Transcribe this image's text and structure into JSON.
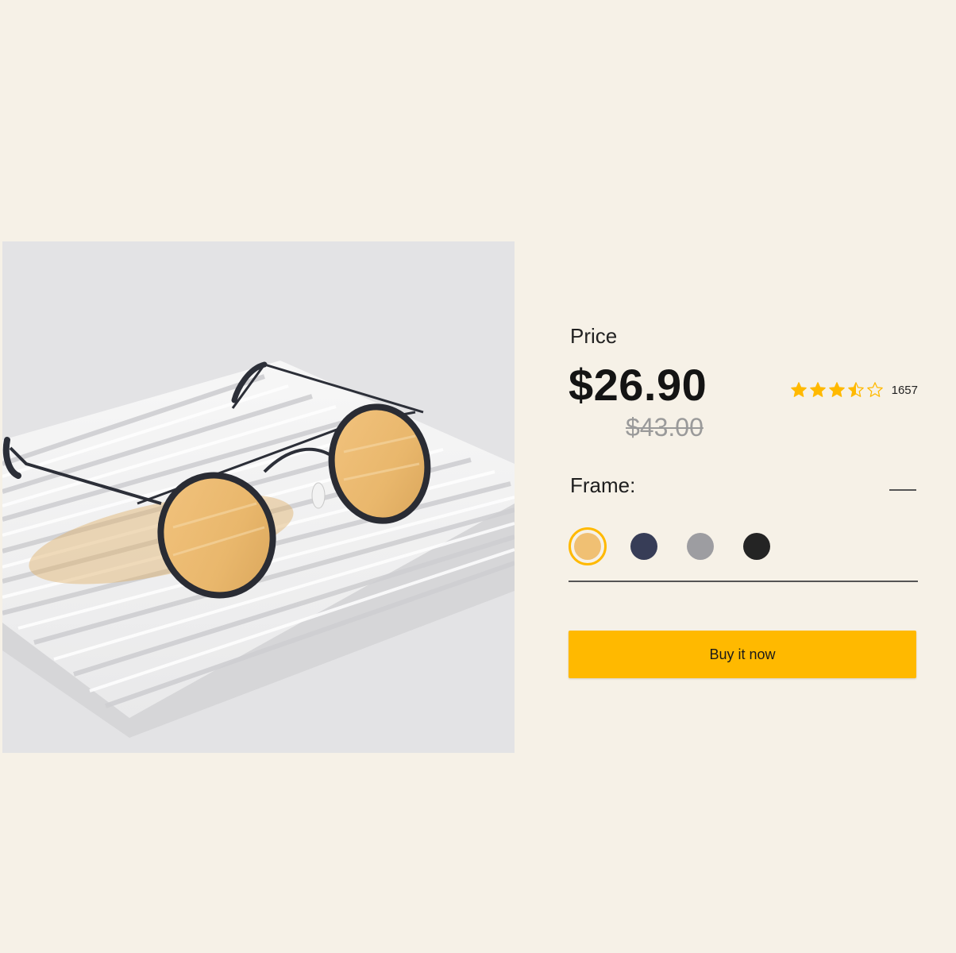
{
  "product": {
    "image_icon": "sunglasses-product-photo"
  },
  "pricing": {
    "label": "Price",
    "current": "$26.90",
    "original": "$43.00"
  },
  "rating": {
    "stars": 3.5,
    "max_stars": 5,
    "count": "1657",
    "star_color": "#ffb900"
  },
  "frame": {
    "label": "Frame:",
    "collapse_icon": "minus-icon",
    "swatches": [
      {
        "name": "amber",
        "color": "#f0c073",
        "selected": true
      },
      {
        "name": "navy",
        "color": "#373d57",
        "selected": false
      },
      {
        "name": "grey",
        "color": "#9d9da1",
        "selected": false
      },
      {
        "name": "black",
        "color": "#242424",
        "selected": false
      }
    ],
    "selected_ring_color": "#ffb900"
  },
  "cta": {
    "buy_label": "Buy it now",
    "color": "#ffb900"
  }
}
